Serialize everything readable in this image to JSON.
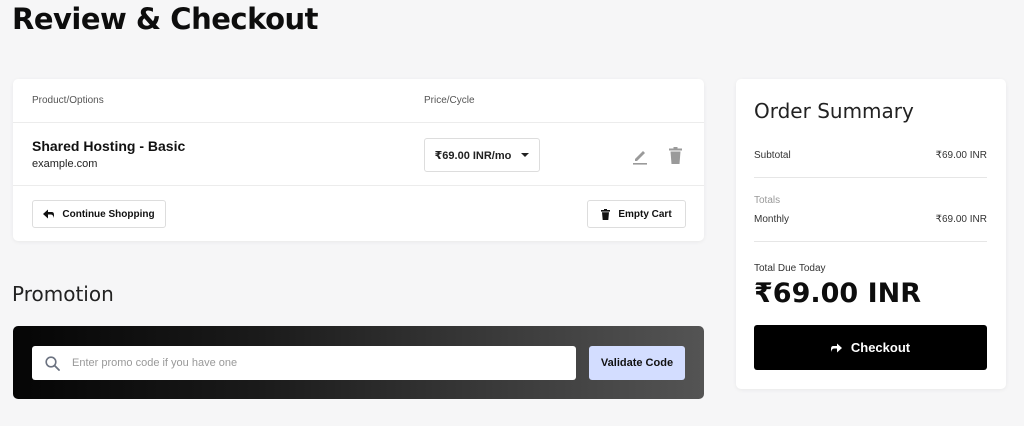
{
  "page": {
    "title": "Review & Checkout"
  },
  "cart": {
    "columns": {
      "product": "Product/Options",
      "price": "Price/Cycle"
    },
    "items": [
      {
        "name": "Shared Hosting - Basic",
        "domain": "example.com",
        "price_cycle": "₹69.00 INR/mo",
        "edit_icon": "pencil-icon",
        "remove_icon": "trash-icon"
      }
    ],
    "continue_label": "Continue Shopping",
    "continue_icon": "arrow-left-icon",
    "empty_label": "Empty Cart",
    "empty_icon": "trash-icon"
  },
  "promotion": {
    "title": "Promotion",
    "placeholder": "Enter promo code if you have one",
    "search_icon": "search-icon",
    "validate_label": "Validate Code"
  },
  "summary": {
    "title": "Order Summary",
    "subtotal_label": "Subtotal",
    "subtotal_value": "₹69.00 INR",
    "totals_label": "Totals",
    "monthly_label": "Monthly",
    "monthly_value": "₹69.00 INR",
    "total_due_label": "Total Due Today",
    "total_due_value": "₹69.00 INR",
    "checkout_label": "Checkout",
    "checkout_icon": "arrow-right-icon"
  },
  "colors": {
    "accent_button": "#d3ddff",
    "checkout_button": "#000000",
    "background": "#f6f6f7"
  }
}
